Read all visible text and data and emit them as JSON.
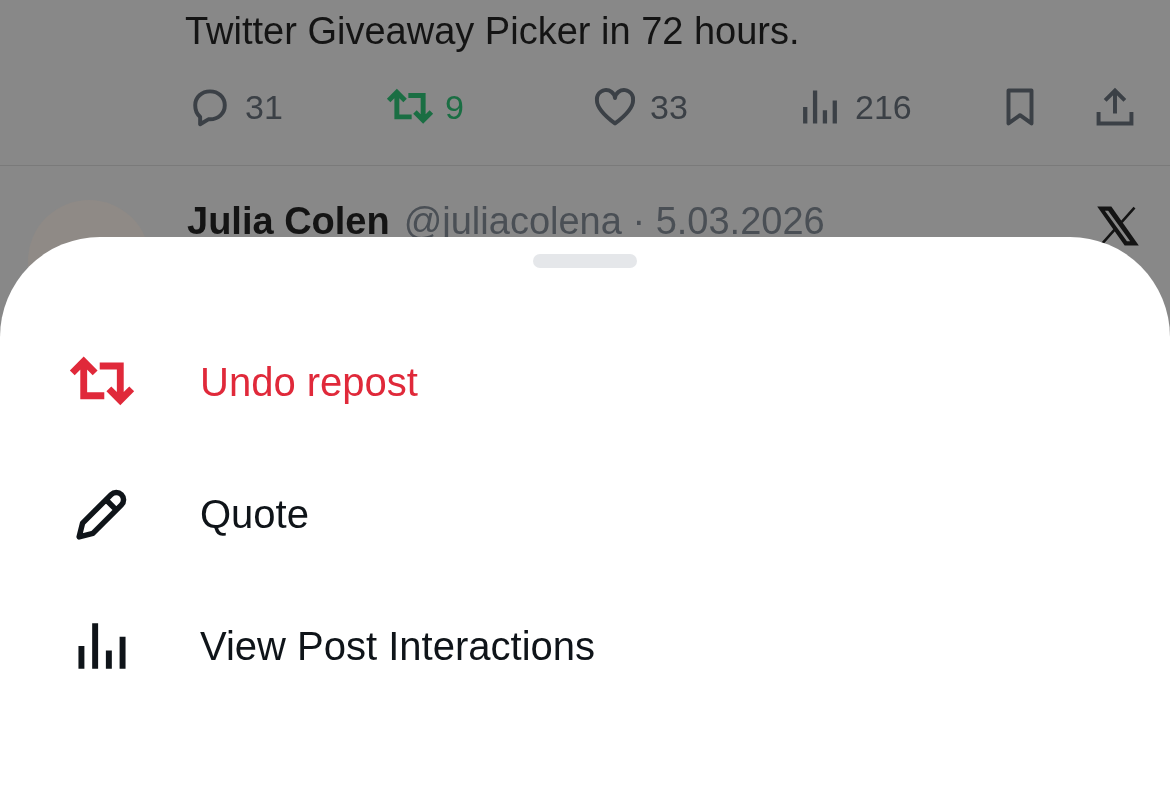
{
  "background_post": {
    "text": "Twitter Giveaway Picker in 72 hours.",
    "actions": [
      {
        "kind": "reply",
        "count": "31",
        "active": false
      },
      {
        "kind": "repost",
        "count": "9",
        "active": true
      },
      {
        "kind": "like",
        "count": "33",
        "active": false
      },
      {
        "kind": "views",
        "count": "216"
      },
      {
        "kind": "bookmark"
      },
      {
        "kind": "share"
      }
    ]
  },
  "next_post": {
    "name": "Julia Colen",
    "handle_date": "@juliacolena · 5.03.2026"
  },
  "sheet": {
    "items": [
      {
        "kind": "repost",
        "label": "Undo repost",
        "destructive": true
      },
      {
        "kind": "quote",
        "label": "Quote",
        "destructive": false
      },
      {
        "kind": "interactions",
        "label": "View Post Interactions",
        "destructive": false
      }
    ]
  }
}
